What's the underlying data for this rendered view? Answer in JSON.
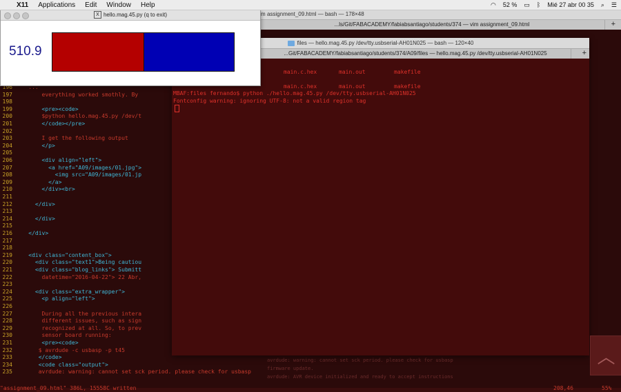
{
  "menubar": {
    "apple": "",
    "app": "X11",
    "items": [
      "Applications",
      "Edit",
      "Window",
      "Help"
    ],
    "battery": "52 %",
    "datetime": "Mié 27 abr  00 35"
  },
  "vim_window": {
    "title": "vim assignment_09.html — bash — 178×48",
    "tabs": [
      "...ls/Git/FABACADEMY/fabiabsantiago/students/374 — vim assignment_09.html"
    ],
    "lines": [
      {
        "n": "196",
        "t": "    ..."
      },
      {
        "n": "197",
        "t": "        everything worked smothly. By"
      },
      {
        "n": "198",
        "t": ""
      },
      {
        "n": "199",
        "t": "        <pre><code>"
      },
      {
        "n": "200",
        "t": "        $python hello.mag.45.py /dev/t"
      },
      {
        "n": "201",
        "t": "        </code></pre>"
      },
      {
        "n": "202",
        "t": ""
      },
      {
        "n": "203",
        "t": "        I get the following output"
      },
      {
        "n": "204",
        "t": "        </p>"
      },
      {
        "n": "205",
        "t": ""
      },
      {
        "n": "206",
        "t": "        <div align=\"left\">"
      },
      {
        "n": "207",
        "t": "          <a href=\"A09/images/01.jpg\">"
      },
      {
        "n": "208",
        "t": "            <img src=\"A09/images/01.jp"
      },
      {
        "n": "209",
        "t": "          </a>"
      },
      {
        "n": "210",
        "t": "        </div><br>"
      },
      {
        "n": "211",
        "t": ""
      },
      {
        "n": "212",
        "t": "      </div>"
      },
      {
        "n": "213",
        "t": ""
      },
      {
        "n": "214",
        "t": "      </div>"
      },
      {
        "n": "215",
        "t": ""
      },
      {
        "n": "216",
        "t": "    </div>"
      },
      {
        "n": "217",
        "t": ""
      },
      {
        "n": "218",
        "t": ""
      },
      {
        "n": "219",
        "t": "    <div class=\"content_box\">"
      },
      {
        "n": "220",
        "t": "      <div class=\"text1\">Being cautiou"
      },
      {
        "n": "221",
        "t": "      <div class=\"blog_links\"> Submitt"
      },
      {
        "n": "222",
        "t": "        datetime=\"2016-04-22\"> 22 Abr,"
      },
      {
        "n": "223",
        "t": ""
      },
      {
        "n": "224",
        "t": "      <div class=\"extra_wrapper\">"
      },
      {
        "n": "225",
        "t": "        <p align=\"left\">"
      },
      {
        "n": "226",
        "t": ""
      },
      {
        "n": "227",
        "t": "        During all the previous intera"
      },
      {
        "n": "228",
        "t": "        different issues, such as sign"
      },
      {
        "n": "229",
        "t": "        recognized at all. So, to prev"
      },
      {
        "n": "230",
        "t": "        sensor board running:"
      },
      {
        "n": "231",
        "t": "        <pre><code>"
      },
      {
        "n": "232",
        "t": "       $ avrdude -c usbasp -p t45"
      },
      {
        "n": "233",
        "t": "       </code>"
      },
      {
        "n": "234",
        "t": "       <code class=\"output\">"
      },
      {
        "n": "235",
        "t": "       avrdude: warning: cannot set sck period. please check for usbasp"
      }
    ],
    "status_left": "\"assignment_09.html\" 386L, 15558C written",
    "status_pos": "208,46",
    "status_pct": "55%"
  },
  "file_window": {
    "title": "files — hello.mag.45.py /dev/tty.usbserial-AH01N025 — bash — 120×40",
    "tabs": [
      "...Git/FABACADEMY/fabiabsantiago/students/374/A09/files — hello.mag.45.py /dev/tty.usbserial-AH01N025"
    ],
    "listing": [
      [
        "main.c.hex",
        "main.out",
        "makefile"
      ],
      [
        "main.c.hex",
        "main.out",
        "makefile"
      ]
    ],
    "prompt": "MBAF:files fernando$ python ./hello.mag.45.py /dev/tty.usbserial-AH01N025",
    "warning": "Fontconfig warning: ignoring UTF-8: not a valid region tag"
  },
  "back_lines": [
    "avrdude: warning: cannot set sck period. please check for usbasp",
    "firmware update.",
    "avrdude: AVR device initialized and ready to accept instructions"
  ],
  "hello_window": {
    "title": "hello.mag.45.py (q to exit)",
    "readout": "510.9",
    "fill_fraction": 0.5,
    "colors": {
      "left": "#b40000",
      "right": "#0000b4",
      "text": "#1a1a8c"
    }
  }
}
